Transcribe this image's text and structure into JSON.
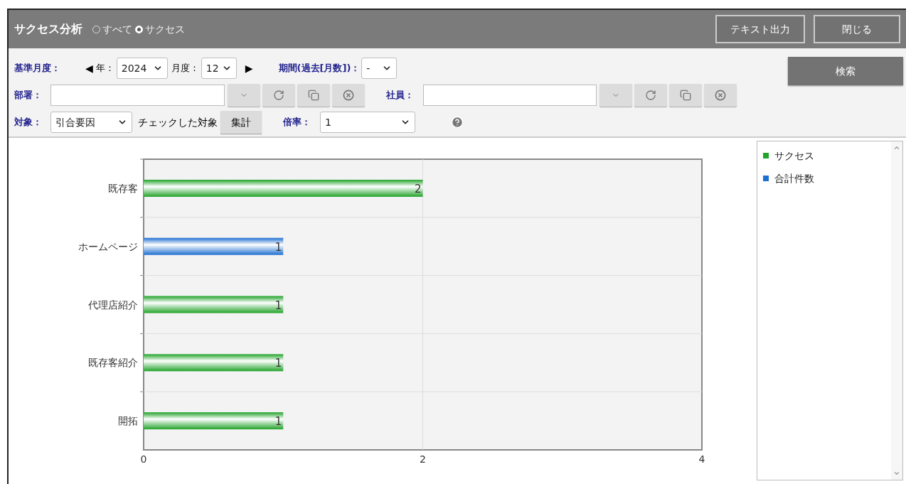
{
  "header": {
    "title": "サクセス分析",
    "filter_options": [
      {
        "label": "すべて",
        "selected": false
      },
      {
        "label": "サクセス",
        "selected": true
      }
    ],
    "buttons": [
      "テキスト出力",
      "閉じる"
    ]
  },
  "form": {
    "base_month_label": "基準月度：",
    "prev_arrow": "◀",
    "next_arrow": "▶",
    "year_label": "年：",
    "year": "2024",
    "month_label": "月度：",
    "month": "12",
    "period_label": "期間(過去[月数])：",
    "period": "-",
    "department_label": "部署：",
    "employee_label": "社員：",
    "target_label": "対象：",
    "target": "引合要因",
    "checked_target_label": "チェックした対象",
    "aggregate_button": "集計",
    "ratio_label": "倍率：",
    "ratio": "1",
    "search_button": "検索"
  },
  "chart": {
    "chart_data": {
      "type": "bar",
      "orientation": "horizontal",
      "categories": [
        "既存客",
        "ホームページ",
        "代理店紹介",
        "既存客紹介",
        "開拓"
      ],
      "series": [
        {
          "name": "サクセス",
          "color": "#22a32a",
          "values": [
            2,
            null,
            1,
            1,
            1
          ]
        },
        {
          "name": "合計件数",
          "color": "#1f6fd1",
          "values": [
            null,
            1,
            null,
            null,
            null
          ]
        }
      ],
      "xlim": [
        0,
        4
      ],
      "xticks": [
        0,
        2,
        4
      ],
      "data_labels": true
    }
  }
}
